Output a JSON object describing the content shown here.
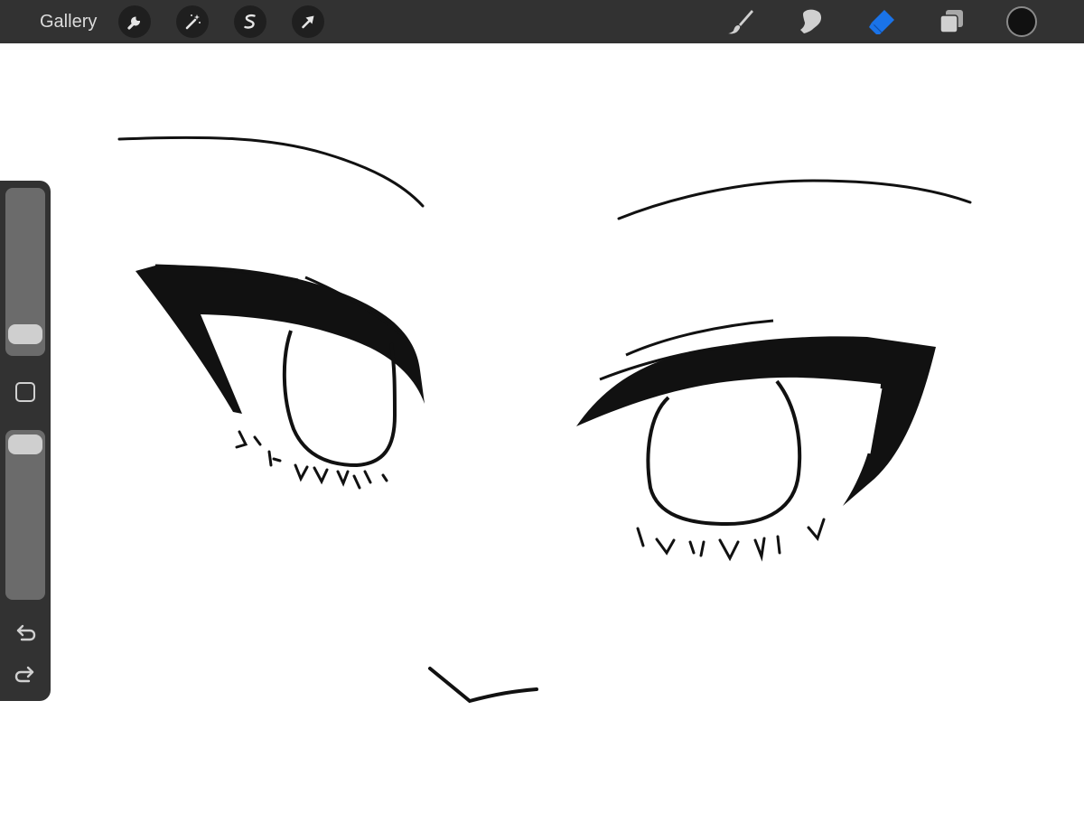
{
  "toolbar": {
    "gallery_label": "Gallery",
    "left_tools": [
      {
        "name": "actions",
        "icon": "wrench-icon"
      },
      {
        "name": "adjustments",
        "icon": "magic-wand-icon"
      },
      {
        "name": "selection",
        "icon": "selection-s-icon"
      },
      {
        "name": "transform",
        "icon": "arrow-cursor-icon"
      }
    ],
    "right_tools": [
      {
        "name": "brush",
        "icon": "brush-icon",
        "active": false
      },
      {
        "name": "smudge",
        "icon": "smudge-finger-icon",
        "active": false
      },
      {
        "name": "eraser",
        "icon": "eraser-icon",
        "active": true
      },
      {
        "name": "layers",
        "icon": "layers-icon",
        "active": false
      }
    ],
    "current_color": "#111111"
  },
  "sidebar": {
    "brush_size_level": 0.05,
    "opacity_level": 1.0,
    "modify_icon": "square-modify-icon",
    "undo_icon": "undo-arrow-icon",
    "redo_icon": "redo-arrow-icon"
  },
  "colors": {
    "toolbar_bg": "#323232",
    "active_tool": "#1a73e8",
    "icon_default": "#d0d0d0",
    "ink": "#111111",
    "canvas_bg": "#ffffff"
  }
}
